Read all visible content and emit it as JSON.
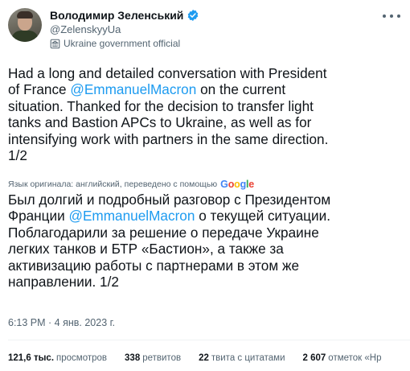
{
  "author": {
    "display_name": "Володимир Зеленський",
    "handle": "@ZelenskyyUa",
    "label": "Ukraine government official"
  },
  "tweet": {
    "en_lines": [
      [
        "Had a long and detailed conversation with President"
      ],
      [
        "of France ",
        "@EmmanuelMacron",
        " on the current"
      ],
      [
        "situation. Thanked for the decision to transfer light"
      ],
      [
        "tanks and Bastion APCs to Ukraine, as well as for"
      ],
      [
        "intensifying work with partners in the same direction."
      ],
      [
        "1/2"
      ]
    ],
    "translation_note": "Язык оригинала: английский, переведено с помощью",
    "translation_provider": "Google",
    "ru_lines": [
      [
        "Был долгий и подробный разговор с Президентом"
      ],
      [
        "Франции ",
        "@EmmanuelMacron",
        " о текущей ситуации."
      ],
      [
        "Поблагодарили за решение о передаче Украине"
      ],
      [
        "легких танков и БТР «Бастион», а также за"
      ],
      [
        "активизацию работы с партнерами в этом же"
      ],
      [
        "направлении. 1/2"
      ]
    ],
    "timestamp": "6:13 PM · 4 янв. 2023 г."
  },
  "stats": [
    {
      "num": "121,6 тыс.",
      "label": "просмотров"
    },
    {
      "num": "338",
      "label": "ретвитов"
    },
    {
      "num": "22",
      "label": "твита с цитатами"
    },
    {
      "num": "2 607",
      "label": "отметок «Нр"
    }
  ],
  "colors": {
    "text": "#0f1419",
    "secondary": "#536471",
    "link": "#1d9bf0",
    "verified": "#1d9bf0"
  },
  "icons": {
    "verified": "verified-badge-icon",
    "government": "government-building-icon",
    "more": "more-options-icon"
  }
}
